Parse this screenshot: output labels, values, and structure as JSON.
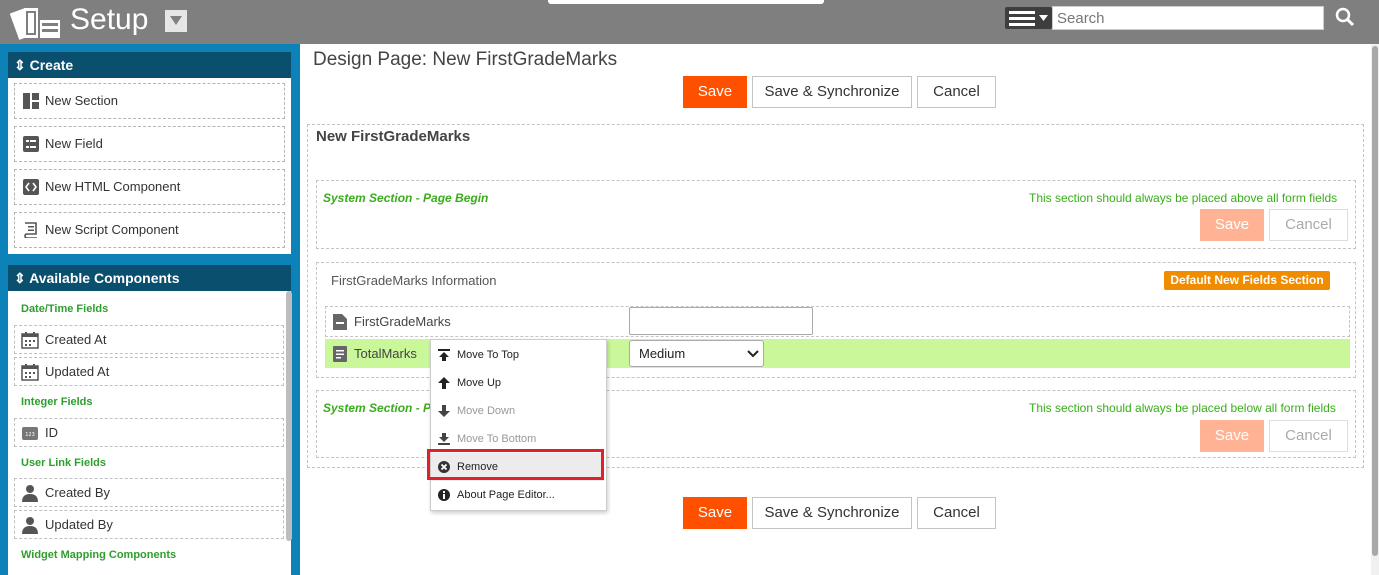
{
  "app": {
    "title": "Setup"
  },
  "search": {
    "placeholder": "Search"
  },
  "sidebar": {
    "create_title": "Create",
    "create_items": [
      "New Section",
      "New Field",
      "New HTML Component",
      "New Script Component"
    ],
    "components_title": "Available Components",
    "groups": [
      {
        "label": "Date/Time Fields",
        "items": [
          "Created At",
          "Updated At"
        ]
      },
      {
        "label": "Integer Fields",
        "items": [
          "ID"
        ]
      },
      {
        "label": "User Link Fields",
        "items": [
          "Created By",
          "Updated By"
        ]
      },
      {
        "label": "Widget Mapping Components",
        "items": []
      }
    ]
  },
  "main": {
    "page_title": "Design Page: New FirstGradeMarks",
    "save_label": "Save",
    "save_sync_label": "Save & Synchronize",
    "cancel_label": "Cancel",
    "form_title": "New FirstGradeMarks",
    "begin_section": {
      "label": "System Section - Page Begin",
      "note": "This section should always be placed above all form fields"
    },
    "info_section": {
      "title": "FirstGradeMarks Information",
      "badge": "Default New Fields Section"
    },
    "fields": [
      {
        "label": "FirstGradeMarks",
        "value": ""
      },
      {
        "label": "TotalMarks",
        "value": "Medium"
      }
    ],
    "end_section": {
      "label": "System Section - P",
      "note": "This section should always be placed below all form fields"
    }
  },
  "context_menu": {
    "items": [
      {
        "label": "Move To Top",
        "enabled": true
      },
      {
        "label": "Move Up",
        "enabled": true
      },
      {
        "label": "Move Down",
        "enabled": false
      },
      {
        "label": "Move To Bottom",
        "enabled": false
      },
      {
        "label": "Remove",
        "enabled": true,
        "highlighted": true
      },
      {
        "label": "About Page Editor...",
        "enabled": true
      }
    ]
  },
  "colors": {
    "accent": "#ff5000",
    "sidebar": "#0d82b9",
    "panel_header": "#0a4f6e",
    "green": "#3aad1b",
    "badge": "#f08c00",
    "highlight_border": "#e0202a",
    "row_highlight": "#c9f799"
  }
}
